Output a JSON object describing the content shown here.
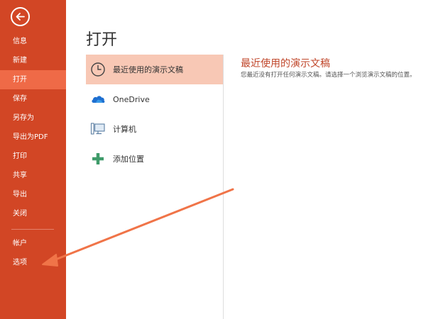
{
  "sidebar": {
    "back_icon": "back-arrow-icon",
    "items": [
      {
        "label": "信息"
      },
      {
        "label": "新建"
      },
      {
        "label": "打开",
        "active": true
      },
      {
        "label": "保存"
      },
      {
        "label": "另存为"
      },
      {
        "label": "导出为PDF"
      },
      {
        "label": "打印"
      },
      {
        "label": "共享"
      },
      {
        "label": "导出"
      },
      {
        "label": "关闭"
      },
      {
        "label": "帐户"
      },
      {
        "label": "选项"
      }
    ]
  },
  "main": {
    "title": "打开",
    "locations": [
      {
        "label": "最近使用的演示文稿",
        "icon": "clock-icon",
        "active": true
      },
      {
        "label": "OneDrive",
        "icon": "cloud-icon"
      },
      {
        "label": "计算机",
        "icon": "computer-icon"
      },
      {
        "label": "添加位置",
        "icon": "plus-icon"
      }
    ],
    "recent": {
      "title": "最近使用的演示文稿",
      "description": "您最近没有打开任何演示文稿。请选择一个浏览演示文稿的位置。"
    }
  },
  "colors": {
    "sidebar_bg": "#d24625",
    "sidebar_active": "#ef6a47",
    "location_active": "#f8c8b5",
    "accent_text": "#c0462a",
    "arrow": "#f07448"
  }
}
